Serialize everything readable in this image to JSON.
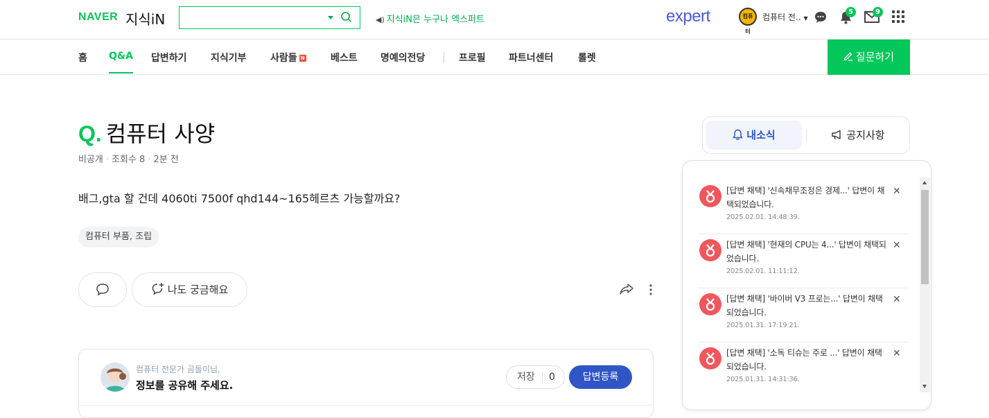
{
  "header": {
    "logo_naver": "NAVER",
    "logo_kin": "지식iN",
    "search_value": "",
    "notice": "지식iN은 누구나 엑스퍼트",
    "expert_logo": "expert",
    "avatar_text": "컴퓨터",
    "username": "컴퓨터 전..",
    "alarm_count": "5",
    "mail_count": "9"
  },
  "nav": {
    "items": [
      "홈",
      "Q&A",
      "답변하기",
      "지식기부",
      "사람들",
      "베스트",
      "명예의전당",
      "프로필",
      "파트너센터",
      "롤렛"
    ],
    "new_badge": "N",
    "active": "Q&A",
    "ask_button": "질문하기"
  },
  "question": {
    "q_mark": "Q.",
    "title": "컴퓨터 사양",
    "visibility": "비공개",
    "views": "조회수 8",
    "time": "2분 전",
    "body": "배그,gta 할 건데 4060ti 7500f qhd144~165헤르츠 가능할까요?",
    "tag": "컴퓨터 부품, 조립",
    "curious_label": "나도 궁금해요"
  },
  "answer_card": {
    "subtitle": "컴퓨터 전문가 곰돌이님,",
    "prompt": "정보를 공유해 주세요.",
    "save_label": "저장",
    "save_count": "0",
    "answer_button": "답변등록"
  },
  "side": {
    "tab_news": "내소식",
    "tab_notice": "공지사항",
    "notifications": [
      {
        "text": "[답변 채택] '신속채무조정은 경제...' 답변이 채택되었습니다.",
        "time": "2025.02.01. 14:48:39."
      },
      {
        "text": "[답변 채택] '현재의 CPU는 4...' 답변이 채택되었습니다.",
        "time": "2025.02.01. 11:11:12."
      },
      {
        "text": "[답변 채택] '바이버 V3 프로는...' 답변이 채택되었습니다.",
        "time": "2025.01.31. 17:19:21."
      },
      {
        "text": "[답변 채택] '소독 티슈는 주로 ...' 답변이 채택되었습니다.",
        "time": "2025.01.31. 14:31:36."
      }
    ]
  },
  "colors": {
    "brand_green": "#03c75a",
    "expert_blue": "#4a5bd8",
    "answer_blue": "#2f56c4",
    "notify_red": "#f0575d"
  }
}
